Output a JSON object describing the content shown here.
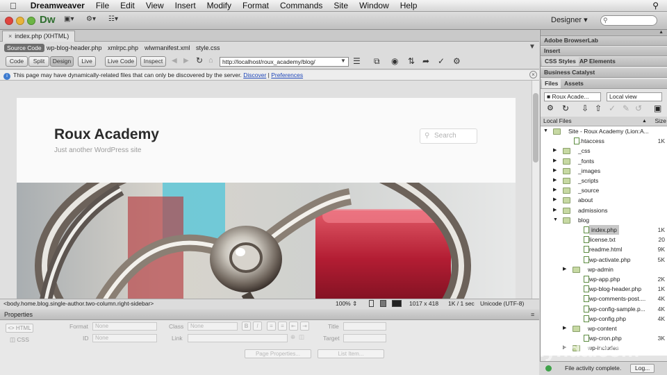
{
  "menubar": {
    "app": "Dreamweaver",
    "items": [
      "File",
      "Edit",
      "View",
      "Insert",
      "Modify",
      "Format",
      "Commands",
      "Site",
      "Window",
      "Help"
    ]
  },
  "appbar": {
    "logo": "Dw",
    "workspace": "Designer"
  },
  "document": {
    "tab": "index.php (XHTML)",
    "related": [
      "Source Code",
      "wp-blog-header.php",
      "xmlrpc.php",
      "wlwmanifest.xml",
      "style.css"
    ],
    "views": [
      "Code",
      "Split",
      "Design"
    ],
    "live": "Live",
    "live_code": "Live Code",
    "inspect": "Inspect",
    "url": "http://localhost/roux_academy/blog/",
    "info_text": "This page may have dynamically-related files that can only be discovered by the server.",
    "discover": "Discover",
    "separator": "|",
    "preferences": "Preferences"
  },
  "page": {
    "site_title": "Roux Academy",
    "tagline": "Just another WordPress site",
    "search_placeholder": "Search"
  },
  "status": {
    "tag": "<body.home.blog.single-author.two-column.right-sidebar>",
    "zoom": "100%",
    "dims": "1017 x 418",
    "size": "1K / 1 sec",
    "encoding": "Unicode (UTF-8)"
  },
  "properties": {
    "title": "Properties",
    "html": "HTML",
    "css": "CSS",
    "format_label": "Format",
    "format_value": "None",
    "class_label": "Class",
    "class_value": "None",
    "id_label": "ID",
    "id_value": "None",
    "link_label": "Link",
    "title_label": "Title",
    "target_label": "Target",
    "bold": "B",
    "italic": "I",
    "page_props": "Page Properties...",
    "list_item": "List Item..."
  },
  "panel": {
    "browserlab": "Adobe BrowserLab",
    "insert": "Insert",
    "css_styles": "CSS Styles",
    "ap_elements": "AP Elements",
    "business_catalyst": "Business Catalyst",
    "files": "Files",
    "assets": "Assets",
    "site_select": "Roux Acade...",
    "view_select": "Local view",
    "col_local": "Local Files",
    "col_size": "Size",
    "tree": [
      {
        "name": "Site - Roux Academy (Lion:A...",
        "size": "",
        "type": "site",
        "depth": 0,
        "tri": "open"
      },
      {
        "name": ".htaccess",
        "size": "1K",
        "type": "file",
        "depth": 1,
        "tri": ""
      },
      {
        "name": "_css",
        "size": "",
        "type": "folder",
        "depth": 1,
        "tri": "closed"
      },
      {
        "name": "_fonts",
        "size": "",
        "type": "folder",
        "depth": 1,
        "tri": "closed"
      },
      {
        "name": "_images",
        "size": "",
        "type": "folder",
        "depth": 1,
        "tri": "closed"
      },
      {
        "name": "_scripts",
        "size": "",
        "type": "folder",
        "depth": 1,
        "tri": "closed"
      },
      {
        "name": "_source",
        "size": "",
        "type": "folder",
        "depth": 1,
        "tri": "closed"
      },
      {
        "name": "about",
        "size": "",
        "type": "folder",
        "depth": 1,
        "tri": "closed"
      },
      {
        "name": "admissions",
        "size": "",
        "type": "folder",
        "depth": 1,
        "tri": "closed"
      },
      {
        "name": "blog",
        "size": "",
        "type": "folder",
        "depth": 1,
        "tri": "open"
      },
      {
        "name": "index.php",
        "size": "1K",
        "type": "file",
        "depth": 2,
        "tri": "",
        "selected": true
      },
      {
        "name": "license.txt",
        "size": "20",
        "type": "file",
        "depth": 2,
        "tri": ""
      },
      {
        "name": "readme.html",
        "size": "9K",
        "type": "file",
        "depth": 2,
        "tri": ""
      },
      {
        "name": "wp-activate.php",
        "size": "5K",
        "type": "file",
        "depth": 2,
        "tri": ""
      },
      {
        "name": "wp-admin",
        "size": "",
        "type": "folder",
        "depth": 2,
        "tri": "closed"
      },
      {
        "name": "wp-app.php",
        "size": "2K",
        "type": "file",
        "depth": 2,
        "tri": ""
      },
      {
        "name": "wp-blog-header.php",
        "size": "1K",
        "type": "file",
        "depth": 2,
        "tri": ""
      },
      {
        "name": "wp-comments-post....",
        "size": "4K",
        "type": "file",
        "depth": 2,
        "tri": ""
      },
      {
        "name": "wp-config-sample.p...",
        "size": "4K",
        "type": "file",
        "depth": 2,
        "tri": ""
      },
      {
        "name": "wp-config.php",
        "size": "4K",
        "type": "file",
        "depth": 2,
        "tri": ""
      },
      {
        "name": "wp-content",
        "size": "",
        "type": "folder",
        "depth": 2,
        "tri": "closed"
      },
      {
        "name": "wp-cron.php",
        "size": "3K",
        "type": "file",
        "depth": 2,
        "tri": ""
      },
      {
        "name": "wp-includes",
        "size": "",
        "type": "folder",
        "depth": 2,
        "tri": "closed"
      }
    ],
    "footer_status": "File activity complete.",
    "log": "Log..."
  },
  "watermark": "lynda.com",
  "colors": {
    "accent_green": "#2f6e2f",
    "link_blue": "#1d45b8",
    "selection": "#c7c7c7"
  }
}
